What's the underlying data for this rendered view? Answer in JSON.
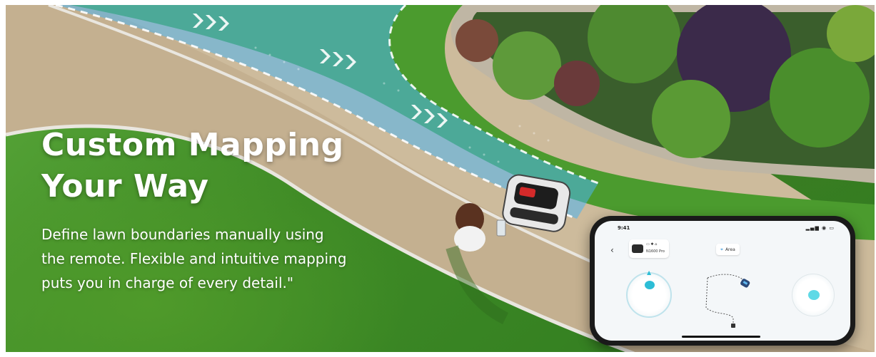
{
  "hero": {
    "headline_line1": "Custom Mapping",
    "headline_line2": "Your Way",
    "description_line1": "Define lawn boundaries manually using",
    "description_line2": "the remote. Flexible and intuitive mapping",
    "description_line3": "puts you in charge of every detail.\""
  },
  "phone": {
    "status_time": "9:41",
    "status_icons": "▂▄▆ ◉ ▭",
    "back_icon": "‹",
    "device_status_icons": "▭ ✱ ⌂",
    "device_name": "N1600 Pro",
    "area_label": "Area",
    "area_icon": "⌖"
  },
  "colors": {
    "text_white": "#ffffff",
    "accent_cyan": "#2dbdd6",
    "path_blue": "#4fb4f0",
    "grass_green": "#4a9a2c",
    "gravel_tan": "#cbb89a"
  }
}
